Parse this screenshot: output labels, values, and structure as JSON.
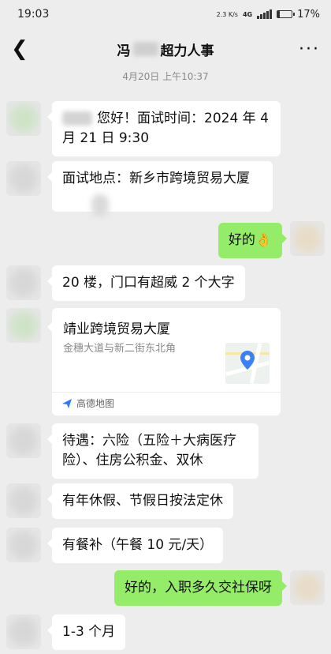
{
  "status": {
    "time": "19:03",
    "net_speed": "2.3 K/s",
    "network": "4G",
    "battery": "17%"
  },
  "header": {
    "title_prefix": "冯",
    "title_suffix": "超力人事"
  },
  "timestamp": "4月20日 上午10:37",
  "messages": {
    "m1": "您好！面试时间：2024 年 4月 21 日 9:30",
    "m2": "面试地点：新乡市跨境贸易大厦",
    "m3": "好的",
    "m3_emoji": "👌",
    "m4": "20 楼，门口有超威 2 个大字",
    "m6": "待遇：六险（五险＋大病医疗险）、住房公积金、双休",
    "m7": "有年休假、节假日按法定休",
    "m8": "有餐补（午餐 10 元/天）",
    "m9": "好的，入职多久交社保呀",
    "m10": "1-3 个月"
  },
  "location": {
    "name": "靖业跨境贸易大厦",
    "address": "金穗大道与新二街东北角",
    "provider": "高德地图"
  },
  "colors": {
    "sent_bubble": "#95ec69",
    "received_bubble": "#ffffff",
    "background": "#ededed",
    "map_pin": "#3d7ff5"
  }
}
